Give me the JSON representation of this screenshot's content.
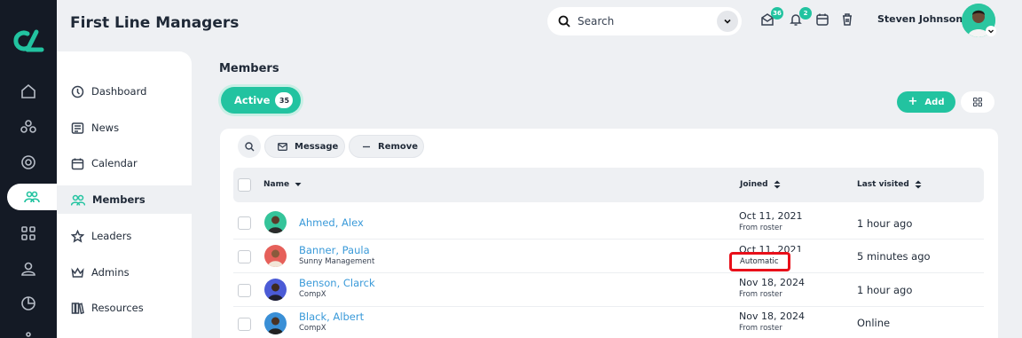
{
  "header": {
    "title": "First Line Managers",
    "search_label": "Search",
    "messages_badge": "36",
    "notifications_badge": "2",
    "user_name": "Steven Johnson"
  },
  "subnav": {
    "items": [
      {
        "label": "Dashboard",
        "icon": "dashboard-icon"
      },
      {
        "label": "News",
        "icon": "news-icon"
      },
      {
        "label": "Calendar",
        "icon": "calendar-icon"
      },
      {
        "label": "Members",
        "icon": "members-icon",
        "active": true
      },
      {
        "label": "Leaders",
        "icon": "star-icon"
      },
      {
        "label": "Admins",
        "icon": "crown-icon"
      },
      {
        "label": "Resources",
        "icon": "books-icon"
      }
    ]
  },
  "main": {
    "title": "Members",
    "active_label": "Active",
    "active_count": "35",
    "add_label": "Add",
    "toolbar": {
      "message_label": "Message",
      "remove_label": "Remove"
    },
    "columns": {
      "name": "Name",
      "joined": "Joined",
      "last_visited": "Last visited"
    },
    "rows": [
      {
        "name": "Ahmed, Alex",
        "org": "",
        "joined": "Oct 11, 2021",
        "joined_sub": "From roster",
        "last": "1 hour ago"
      },
      {
        "name": "Banner, Paula",
        "org": "Sunny Management",
        "joined": "Oct 11, 2021",
        "joined_sub": "Automatic",
        "last": "5 minutes ago"
      },
      {
        "name": "Benson, Clarck",
        "org": "CompX",
        "joined": "Nov 18, 2024",
        "joined_sub": "From roster",
        "last": "1 hour ago"
      },
      {
        "name": "Black, Albert",
        "org": "CompX",
        "joined": "Nov 18, 2024",
        "joined_sub": "From roster",
        "last": "Online"
      }
    ]
  },
  "colors": {
    "accent": "#22c3a0",
    "rail": "#141a25",
    "link": "#3a9ad9",
    "highlight": "#e8101a"
  }
}
